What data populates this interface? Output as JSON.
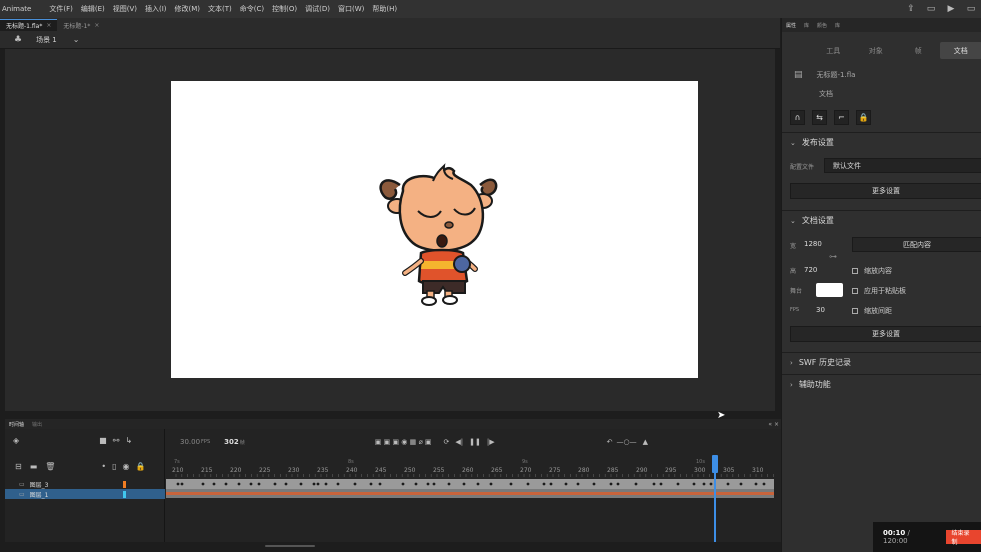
{
  "menubar": {
    "app": "Animate",
    "items": [
      "文件(F)",
      "编辑(E)",
      "视图(V)",
      "插入(I)",
      "修改(M)",
      "文本(T)",
      "命令(C)",
      "控制(O)",
      "调试(D)",
      "窗口(W)",
      "帮助(H)"
    ],
    "icons": [
      "share-icon",
      "layout-icon",
      "play-icon",
      "window-controls-icon"
    ]
  },
  "doc_tabs": [
    {
      "label": "无标题-1.fla*",
      "active": true
    },
    {
      "label": "无标题-1*",
      "active": false
    }
  ],
  "scene": {
    "label": "场景 1"
  },
  "timeline": {
    "tab_active": "时间轴",
    "tab_inactive": "输出",
    "fps": "30.00",
    "fps_unit": "FPS",
    "frame": "302",
    "frame_unit": "帧",
    "layers": [
      {
        "name": "图层_3",
        "color": "#f07d23",
        "selected": false
      },
      {
        "name": "图层_1",
        "color": "#41c7ef",
        "selected": true
      }
    ],
    "ruler_ticks": [
      "210",
      "215",
      "220",
      "225",
      "230",
      "235",
      "240",
      "245",
      "250",
      "255",
      "260",
      "265",
      "270",
      "275",
      "280",
      "285",
      "290",
      "295",
      "300",
      "305",
      "310"
    ],
    "seconds_marks": [
      "7s",
      "8s",
      "9s",
      "10s"
    ],
    "current_frame": 302
  },
  "panel": {
    "tabs": [
      "属性",
      "库",
      "颜色",
      "库"
    ],
    "subtabs": [
      "工具",
      "对象",
      "帧",
      "文档"
    ],
    "active_subtab": "文档",
    "doc_name": "无标题-1.fla",
    "doc_label": "文档",
    "publish_section": "发布设置",
    "profile_label": "配置文件",
    "profile_value": "默认文件",
    "more_settings": "更多设置",
    "doc_section": "文档设置",
    "width_label": "宽",
    "width": "1280",
    "height_label": "高",
    "height": "720",
    "match_contents": "匹配内容",
    "scale_content": "缩放内容",
    "stage_label": "舞台",
    "stage_color": "#ffffff",
    "apply_to_pasteboard": "应用于粘贴板",
    "fps_label": "FPS",
    "fps": "30",
    "scale_spacing": "缩放间距",
    "more_settings2": "更多设置",
    "swf_history": "SWF 历史记录",
    "accessibility": "辅助功能"
  },
  "recorder": {
    "elapsed": "00:10",
    "total": "120:00",
    "stop_label": "结束录制"
  }
}
